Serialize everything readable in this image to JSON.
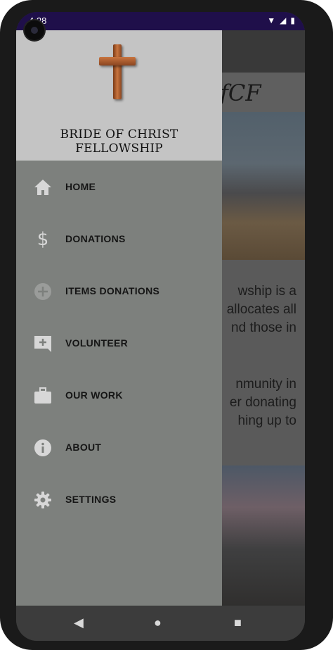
{
  "status_bar": {
    "time": "4:28"
  },
  "drawer": {
    "title": "BRIDE OF CHRIST FELLOWSHIP",
    "items": [
      {
        "label": "HOME",
        "icon": "home-icon"
      },
      {
        "label": "DONATIONS",
        "icon": "dollar-icon"
      },
      {
        "label": "ITEMS DONATIONS",
        "icon": "add-circle-icon"
      },
      {
        "label": "VOLUNTEER",
        "icon": "add-comment-icon"
      },
      {
        "label": "OUR WORK",
        "icon": "briefcase-icon"
      },
      {
        "label": "ABOUT",
        "icon": "info-icon"
      },
      {
        "label": "SETTINGS",
        "icon": "gear-icon"
      }
    ]
  },
  "background_app": {
    "logo_fragment": "fCF",
    "text_lines": [
      "wship is a",
      "allocates all",
      "nd those in",
      "",
      "nmunity in",
      "er donating",
      "hing up to"
    ]
  },
  "colors": {
    "drawer_header": "#c4c4c4",
    "drawer_body": "#7d807d",
    "status_bar": "#1f0f4a"
  }
}
